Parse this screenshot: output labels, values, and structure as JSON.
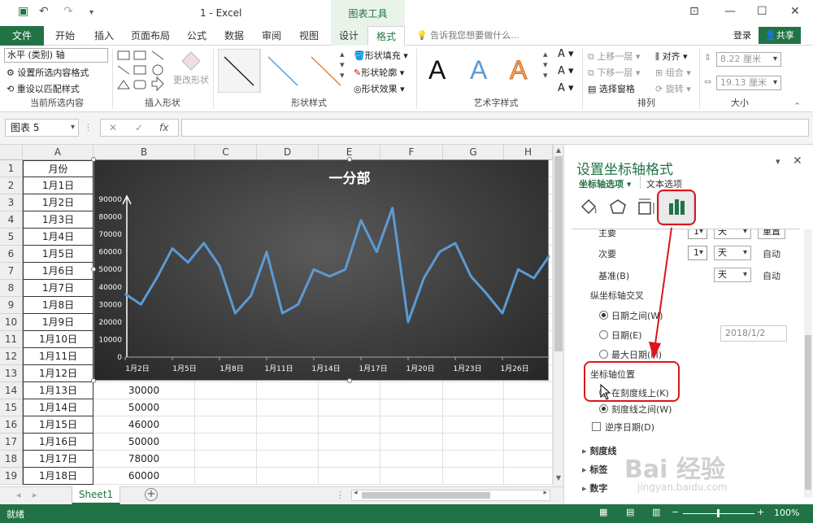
{
  "app": {
    "window_title": "1 - Excel",
    "context_tab": "图表工具"
  },
  "tabs": [
    "文件",
    "开始",
    "插入",
    "页面布局",
    "公式",
    "数据",
    "审阅",
    "视图",
    "设计",
    "格式"
  ],
  "tell_me": "告诉我您想要做什么...",
  "account": {
    "login": "登录",
    "share": "共享"
  },
  "ribbon": {
    "selection_value": "水平 (类别) 轴",
    "format_selection": "设置所选内容格式",
    "reset_style": "重设以匹配样式",
    "group_current": "当前所选内容",
    "change_shape": "更改形状",
    "group_insert_shapes": "插入形状",
    "group_shape_styles": "形状样式",
    "shape_fill": "形状填充",
    "shape_outline": "形状轮廓",
    "shape_effects": "形状效果",
    "group_wordart": "艺术字样式",
    "bring_forward": "上移一层",
    "send_backward": "下移一层",
    "selection_pane": "选择窗格",
    "align": "对齐",
    "group_obj": "组合",
    "rotate": "旋转",
    "group_arrange": "排列",
    "height": "8.22 厘米",
    "width": "19.13 厘米",
    "group_size": "大小"
  },
  "namebox": "图表 5",
  "columns": [
    "A",
    "B",
    "C",
    "D",
    "E",
    "F",
    "G",
    "H"
  ],
  "rows": [
    1,
    2,
    3,
    4,
    5,
    6,
    7,
    8,
    9,
    10,
    11,
    12,
    13,
    14,
    15,
    16,
    17,
    18,
    19
  ],
  "col_a": [
    "月份",
    "1月1日",
    "1月2日",
    "1月3日",
    "1月4日",
    "1月5日",
    "1月6日",
    "1月7日",
    "1月8日",
    "1月9日",
    "1月10日",
    "1月11日",
    "1月12日",
    "1月13日",
    "1月14日",
    "1月15日",
    "1月16日",
    "1月17日",
    "1月18日"
  ],
  "col_b_visible": {
    "14": "30000",
    "15": "50000",
    "16": "46000",
    "17": "50000",
    "18": "78000",
    "19": "60000"
  },
  "sheet": "Sheet1",
  "status": {
    "ready": "就绪",
    "zoom": "100%"
  },
  "chart_data": {
    "type": "line",
    "title": "一分部",
    "ylim": [
      0,
      90000
    ],
    "yticks": [
      "0",
      "10000",
      "20000",
      "30000",
      "40000",
      "50000",
      "60000",
      "70000",
      "80000",
      "90000"
    ],
    "xtick_labels": [
      "1月2日",
      "1月5日",
      "1月8日",
      "1月11日",
      "1月14日",
      "1月17日",
      "1月20日",
      "1月23日",
      "1月26日"
    ],
    "series": [
      {
        "color": "#5b9bd5",
        "values": [
          36000,
          30000,
          45000,
          62000,
          54000,
          65000,
          52000,
          25000,
          35000,
          60000,
          25000,
          30000,
          50000,
          46000,
          50000,
          78000,
          60000,
          85000,
          20000,
          45000,
          60000,
          65000,
          46000,
          36000,
          25000,
          50000,
          45000,
          58000
        ]
      }
    ],
    "grid": false
  },
  "pane": {
    "title": "设置坐标轴格式",
    "tab_axis": "坐标轴选项",
    "tab_text": "文本选项",
    "main_label": "主要",
    "main_value": "1",
    "main_unit": "天",
    "reset": "重置",
    "minor_label": "次要",
    "minor_value": "1",
    "minor_unit": "天",
    "auto1": "自动",
    "base_label": "基准(B)",
    "base_unit": "天",
    "auto2": "自动",
    "cross_heading": "纵坐标轴交叉",
    "opt_between_dates": "日期之间(W)",
    "opt_date": "日期(E)",
    "date_value": "2018/1/2",
    "opt_max_date": "最大日期(M)",
    "position_heading": "坐标轴位置",
    "opt_on_tick": "在刻度线上(K)",
    "opt_between_tick": "刻度线之间(W)",
    "reverse_dates": "逆序日期(D)",
    "sec_ticks": "刻度线",
    "sec_labels": "标签",
    "sec_number": "数字"
  },
  "watermark": {
    "main": "Bai 经验",
    "sub": "jingyan.baidu.com"
  }
}
